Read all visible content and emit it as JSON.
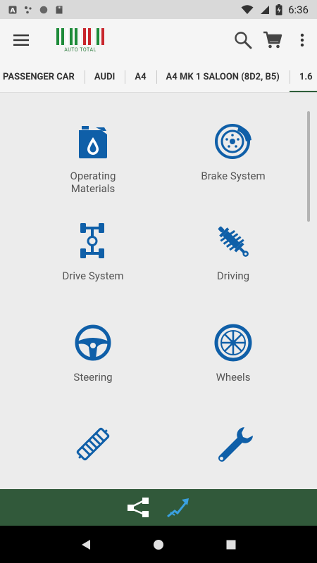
{
  "status_bar": {
    "time": "6:36",
    "left_icons": [
      "a-notification-icon",
      "hub-icon",
      "circle-icon",
      "sd-card-icon"
    ],
    "right_icons": [
      "wifi-icon",
      "signal-icon",
      "battery-charging-icon"
    ]
  },
  "app_bar": {
    "logo_text": "AUTO TOTAL",
    "actions": [
      "search-icon",
      "cart-icon",
      "more-vert-icon"
    ]
  },
  "breadcrumbs": [
    {
      "label": "PASSENGER CAR"
    },
    {
      "label": "AUDI"
    },
    {
      "label": "A4"
    },
    {
      "label": "A4 MK 1 SALOON (8D2, B5)"
    },
    {
      "label": "1.6"
    }
  ],
  "categories": [
    {
      "label": "Operating Materials",
      "icon": "oil-can-icon"
    },
    {
      "label": "Brake System",
      "icon": "brake-disc-icon"
    },
    {
      "label": "Drive System",
      "icon": "drivetrain-icon"
    },
    {
      "label": "Driving",
      "icon": "shock-absorber-icon"
    },
    {
      "label": "Steering",
      "icon": "steering-wheel-icon"
    },
    {
      "label": "Wheels",
      "icon": "wheel-icon"
    },
    {
      "label": "",
      "icon": "exhaust-icon"
    },
    {
      "label": "",
      "icon": "wrench-icon"
    }
  ],
  "colors": {
    "accent_blue": "#0f5fa8",
    "brand_green": "#31593a",
    "logo_green": "#1e8b3a",
    "logo_red": "#c8262c"
  },
  "bottom_bar": {
    "icons": [
      "share-icon",
      "chart-up-icon"
    ]
  },
  "nav_bar": {
    "icons": [
      "back-icon",
      "home-icon",
      "recents-icon"
    ]
  }
}
